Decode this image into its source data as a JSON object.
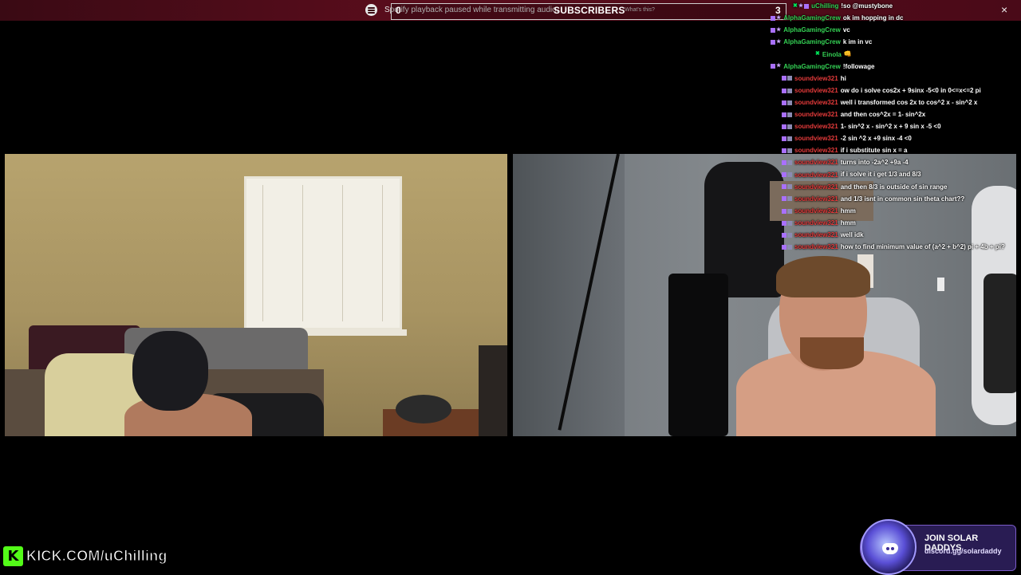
{
  "notification": {
    "icon": "spotify-icon",
    "text": "Spotify playback paused while transmitting audio.",
    "why_link": "What's this?",
    "close": "×"
  },
  "subscribers": {
    "left_count": "0",
    "title": "SUBSCRIBERS",
    "right_count": "3"
  },
  "chat": {
    "messages": [
      {
        "user": "uChilling",
        "text": "!so @mustybone",
        "color": "#34d154",
        "badges": [
          "sword",
          "star",
          "sub"
        ]
      },
      {
        "user": "AlphaGamingCrew",
        "text": "ok im hopping in dc",
        "color": "#34d154",
        "badges": [
          "sub",
          "star"
        ]
      },
      {
        "user": "AlphaGamingCrew",
        "text": "vc",
        "color": "#34d154",
        "badges": [
          "sub",
          "star"
        ]
      },
      {
        "user": "AlphaGamingCrew",
        "text": "k im in vc",
        "color": "#34d154",
        "badges": [
          "sub",
          "star"
        ]
      },
      {
        "user": "Einola",
        "text": "👊",
        "color": "#34d154",
        "badges": [
          "sword"
        ]
      },
      {
        "user": "AlphaGamingCrew",
        "text": "!followage",
        "color": "#34d154",
        "badges": [
          "sub",
          "star"
        ]
      },
      {
        "user": "soundview321",
        "text": "hi",
        "color": "#e43a3a",
        "badges": [
          "sub",
          "gray"
        ]
      },
      {
        "user": "soundview321",
        "text": "ow do i solve cos2x + 9sinx -5<0 in 0<=x<=2 pi",
        "color": "#e43a3a",
        "badges": [
          "sub",
          "gray"
        ]
      },
      {
        "user": "soundview321",
        "text": "well i transformed cos 2x to cos^2 x - sin^2 x",
        "color": "#e43a3a",
        "badges": [
          "sub",
          "gray"
        ]
      },
      {
        "user": "soundview321",
        "text": "and then cos^2x = 1- sin^2x",
        "color": "#e43a3a",
        "badges": [
          "sub",
          "gray"
        ]
      },
      {
        "user": "soundview321",
        "text": "1- sin^2 x - sin^2 x + 9 sin x -5 <0",
        "color": "#e43a3a",
        "badges": [
          "sub",
          "gray"
        ]
      },
      {
        "user": "soundview321",
        "text": "-2 sin ^2 x +9 sinx -4 <0",
        "color": "#e43a3a",
        "badges": [
          "sub",
          "gray"
        ]
      },
      {
        "user": "soundview321",
        "text": "if i substitute sin x = a",
        "color": "#e43a3a",
        "badges": [
          "sub",
          "gray"
        ]
      },
      {
        "user": "soundview321",
        "text": "turns into -2a^2 +9a -4",
        "color": "#e43a3a",
        "badges": [
          "sub",
          "gray"
        ]
      },
      {
        "user": "soundview321",
        "text": "if i solve it i get 1/3 and 8/3",
        "color": "#e43a3a",
        "badges": [
          "sub",
          "gray"
        ]
      },
      {
        "user": "soundview321",
        "text": "and then 8/3 is outside of sin range",
        "color": "#e43a3a",
        "badges": [
          "sub",
          "gray"
        ]
      },
      {
        "user": "soundview321",
        "text": "and 1/3 isnt in common sin theta chart??",
        "color": "#e43a3a",
        "badges": [
          "sub",
          "gray"
        ]
      },
      {
        "user": "soundview321",
        "text": "hmm",
        "color": "#e43a3a",
        "badges": [
          "sub",
          "gray"
        ]
      },
      {
        "user": "soundview321",
        "text": "hmm",
        "color": "#e43a3a",
        "badges": [
          "sub",
          "gray"
        ]
      },
      {
        "user": "soundview321",
        "text": "well idk",
        "color": "#e43a3a",
        "badges": [
          "sub",
          "gray"
        ]
      },
      {
        "user": "soundview321",
        "text": "how to find minimum value of (a^2 + b^2) pi + 4b + pi?",
        "color": "#e43a3a",
        "badges": [
          "sub",
          "gray"
        ]
      }
    ]
  },
  "brand": {
    "logo": "K",
    "url": "KICK.COM/uChilling"
  },
  "discord": {
    "title": "JOIN SOLAR DADDYS",
    "link": "discord.gg/solardaddy"
  }
}
